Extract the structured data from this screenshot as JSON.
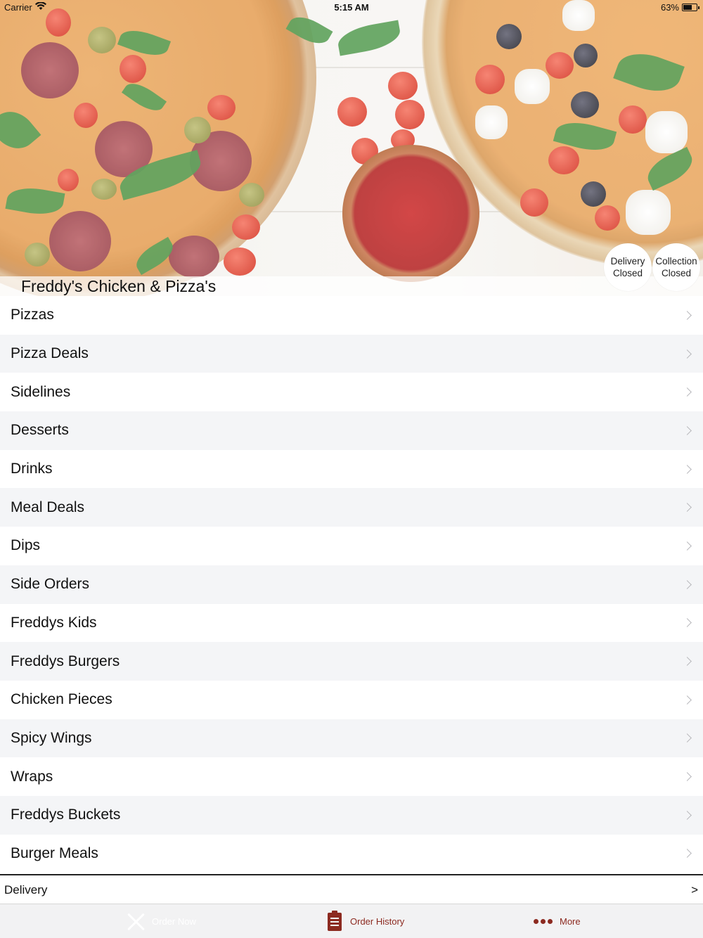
{
  "status_bar": {
    "carrier": "Carrier",
    "time": "5:15 AM",
    "battery": "63%"
  },
  "header": {
    "restaurant_name": "Freddy's Chicken & Pizza's",
    "delivery_status": {
      "line1": "Delivery",
      "line2": "Closed"
    },
    "collection_status": {
      "line1": "Collection",
      "line2": "Closed"
    }
  },
  "menu": {
    "categories": [
      "Pizzas",
      "Pizza Deals",
      "Sidelines",
      "Desserts",
      "Drinks",
      "Meal Deals",
      "Dips",
      "Side Orders",
      "Freddys Kids",
      "Freddys Burgers",
      "Chicken Pieces",
      "Spicy Wings",
      "Wraps",
      "Freddys Buckets",
      "Burger Meals"
    ]
  },
  "order_mode": {
    "label": "Delivery",
    "arrow": ">"
  },
  "tab_bar": {
    "tabs": [
      {
        "label": "Order Now",
        "icon": "utensils-icon"
      },
      {
        "label": "Order History",
        "icon": "clipboard-icon"
      },
      {
        "label": "More",
        "icon": "more-dots-icon"
      }
    ]
  },
  "colors": {
    "accent": "#8c2a20",
    "row_alt": "#f4f5f7",
    "tab_bar_bg": "#f2f2f3"
  }
}
